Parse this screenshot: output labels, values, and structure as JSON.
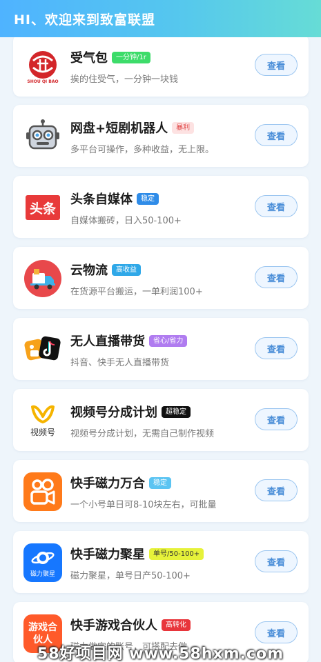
{
  "header": {
    "title": "HI、欢迎来到致富联盟"
  },
  "watermark": "58好项目网 www.58hxm.com",
  "items": [
    {
      "title": "受气包",
      "tag": "一分钟/1r",
      "tag_bg": "#3ddc6a",
      "tag_fg": "#ffffff",
      "desc": "挨的住受气，一分钟一块钱",
      "button": "查看",
      "icon": "seal-icon",
      "icon_text": "受气包",
      "icon_sub": "SHOU QI BAO"
    },
    {
      "title": "网盘+短剧机器人",
      "tag": "暴利",
      "tag_bg": "#fde2e2",
      "tag_fg": "#e04848",
      "desc": "多平台可操作，多种收益，无上限。",
      "button": "查看",
      "icon": "robot-icon"
    },
    {
      "title": "头条自媒体",
      "tag": "稳定",
      "tag_bg": "#2f8ce8",
      "tag_fg": "#ffffff",
      "desc": "自媒体搬砖，日入50-100+",
      "button": "查看",
      "icon": "toutiao-icon",
      "icon_text": "头条"
    },
    {
      "title": "云物流",
      "tag": "高收益",
      "tag_bg": "#2fa8e8",
      "tag_fg": "#ffffff",
      "desc": "在货源平台搬运，一单利润100+",
      "button": "查看",
      "icon": "truck-icon"
    },
    {
      "title": "无人直播带货",
      "tag": "省心/省力",
      "tag_bg": "#b07cf0",
      "tag_fg": "#ffffff",
      "desc": "抖音、快手无人直播带货",
      "button": "查看",
      "icon": "douyin-kuaishou-icon"
    },
    {
      "title": "视频号分成计划",
      "tag": "超稳定",
      "tag_bg": "#111111",
      "tag_fg": "#ffffff",
      "desc": "视频号分成计划，无需自己制作视频",
      "button": "查看",
      "icon": "channels-icon",
      "icon_text": "视频号"
    },
    {
      "title": "快手磁力万合",
      "tag": "稳定",
      "tag_bg": "#5bc4f2",
      "tag_fg": "#ffffff",
      "desc": "一个小号单日可8-10块左右，可批量",
      "button": "查看",
      "icon": "kuaishou-icon"
    },
    {
      "title": "快手磁力聚星",
      "tag": "单号/50-100+",
      "tag_bg": "#e6f23a",
      "tag_fg": "#333333",
      "desc": "磁力聚星，单号日产50-100+",
      "button": "查看",
      "icon": "planet-icon",
      "icon_text": "磁力聚星"
    },
    {
      "title": "快手游戏合伙人",
      "tag": "高转化",
      "tag_bg": "#e8353b",
      "tag_fg": "#ffffff",
      "desc": "磁力做完的账号，可搭配去做",
      "button": "查看",
      "icon": "game-partner-icon",
      "icon_text": "游戏合伙人"
    }
  ]
}
